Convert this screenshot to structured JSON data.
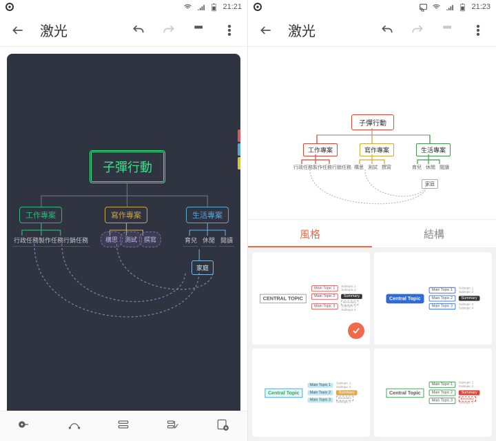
{
  "left": {
    "status_time": "21:21",
    "title": "激光",
    "mindmap": {
      "root": "子彈行動",
      "branches": [
        {
          "label": "工作專案",
          "leaves": [
            "行政任務",
            "製作任務",
            "行銷任務"
          ],
          "color": "#2fb87a"
        },
        {
          "label": "寫作專案",
          "leaves": [
            "構思",
            "測試",
            "撰寫"
          ],
          "color": "#c8a44a"
        },
        {
          "label": "生活專案",
          "leaves": [
            "育兒",
            "休閒",
            "閱讀"
          ],
          "color": "#5aa8d8"
        }
      ],
      "extra_node": "家庭"
    },
    "edge_colors": [
      "#d85a5a",
      "#5aa8d8",
      "#d6c24a"
    ]
  },
  "right": {
    "status_time": "21:23",
    "title": "激光",
    "tabs": {
      "style": "風格",
      "structure": "結構",
      "active": "style"
    },
    "preview": {
      "root": "子彈行動",
      "branches": [
        {
          "label": "工作專案",
          "leaves": [
            "行政任務",
            "製作任務",
            "行銷任務"
          ]
        },
        {
          "label": "寫作專案",
          "leaves": [
            "構思",
            "測試",
            "撰寫"
          ]
        },
        {
          "label": "生活專案",
          "leaves": [
            "育兒",
            "休閒",
            "閱讀"
          ]
        }
      ],
      "extra_node": "家庭"
    },
    "cards": [
      {
        "central": "CENTRAL TOPIC",
        "topic": "Main Topic",
        "sub": "Subtopic",
        "summary": "Summary",
        "boundary": "Boundary",
        "accent": "#d85a5a",
        "ct_style": "plain",
        "selected": true
      },
      {
        "central": "Central Topic",
        "topic": "Main Topic",
        "sub": "Subtopic",
        "summary": "Summary",
        "boundary": "Boundary",
        "accent": "#2e6bd6",
        "ct_style": "pill-blue",
        "selected": false
      },
      {
        "central": "Central Topic",
        "topic": "Main Topic",
        "sub": "Subtopic",
        "summary": "Summary",
        "boundary": "Boundary",
        "accent": "#3aa5c7",
        "ct_style": "pill-teal",
        "selected": false
      },
      {
        "central": "Central Topic",
        "topic": "Main Topic",
        "sub": "Subtopic",
        "summary": "Summary",
        "boundary": "Boundary",
        "accent": "#3a9b4a",
        "ct_style": "plain",
        "selected": false
      }
    ]
  }
}
